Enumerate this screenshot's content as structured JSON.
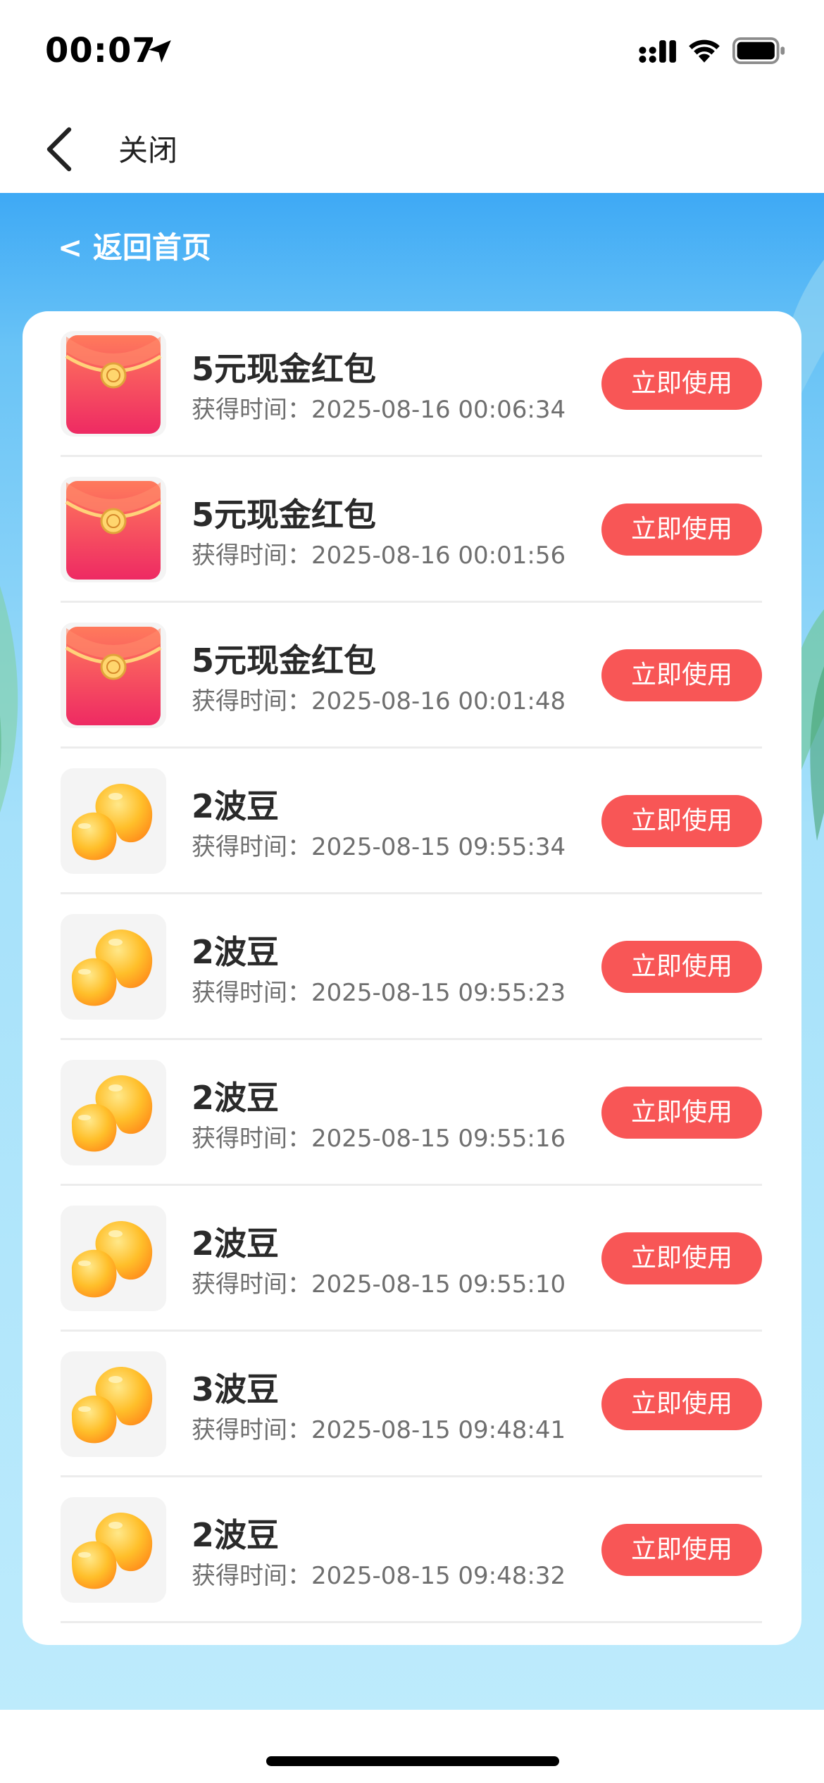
{
  "status_bar": {
    "time": "00:07"
  },
  "nav": {
    "close_label": "关闭"
  },
  "page": {
    "back_home_label": "< 返回首页",
    "colors": {
      "button": "#f85656",
      "sky_top": "#3ea9f5",
      "sky_bottom": "#bdebfc"
    }
  },
  "items": [
    {
      "icon": "red-envelope-icon",
      "title": "5元现金红包",
      "time_label": "获得时间：",
      "time": "2025-08-16 00:06:34",
      "button": "立即使用"
    },
    {
      "icon": "red-envelope-icon",
      "title": "5元现金红包",
      "time_label": "获得时间：",
      "time": "2025-08-16 00:01:56",
      "button": "立即使用"
    },
    {
      "icon": "red-envelope-icon",
      "title": "5元现金红包",
      "time_label": "获得时间：",
      "time": "2025-08-16 00:01:48",
      "button": "立即使用"
    },
    {
      "icon": "beans-icon",
      "title": "2波豆",
      "time_label": "获得时间：",
      "time": "2025-08-15 09:55:34",
      "button": "立即使用"
    },
    {
      "icon": "beans-icon",
      "title": "2波豆",
      "time_label": "获得时间：",
      "time": "2025-08-15 09:55:23",
      "button": "立即使用"
    },
    {
      "icon": "beans-icon",
      "title": "2波豆",
      "time_label": "获得时间：",
      "time": "2025-08-15 09:55:16",
      "button": "立即使用"
    },
    {
      "icon": "beans-icon",
      "title": "2波豆",
      "time_label": "获得时间：",
      "time": "2025-08-15 09:55:10",
      "button": "立即使用"
    },
    {
      "icon": "beans-icon",
      "title": "3波豆",
      "time_label": "获得时间：",
      "time": "2025-08-15 09:48:41",
      "button": "立即使用"
    },
    {
      "icon": "beans-icon",
      "title": "2波豆",
      "time_label": "获得时间：",
      "time": "2025-08-15 09:48:32",
      "button": "立即使用"
    }
  ]
}
